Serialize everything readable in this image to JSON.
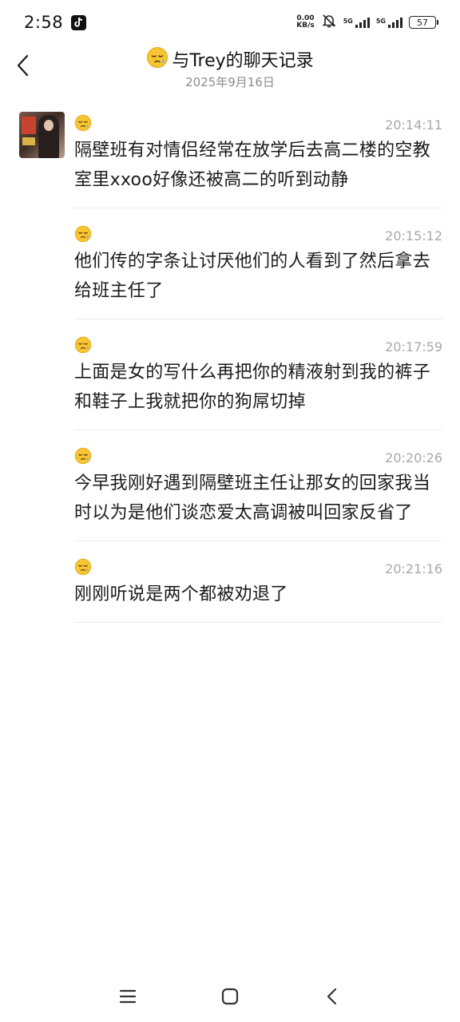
{
  "status_bar": {
    "time": "2:58",
    "net_speed_value": "0.00",
    "net_speed_unit": "KB/s",
    "signal_1_label": "5G",
    "signal_2_label": "5G",
    "battery_level": "57",
    "icons": [
      "tiktok-icon",
      "mute-bell-icon",
      "signal-icon",
      "battery-icon"
    ]
  },
  "header": {
    "title_emoji": "sleepy-face-icon",
    "title": "与Trey的聊天记录",
    "date": "2025年9月16日"
  },
  "messages": [
    {
      "time": "20:14:11",
      "text": "隔壁班有对情侣经常在放学后去高二楼的空教室里xxoo好像还被高二的听到动静"
    },
    {
      "time": "20:15:12",
      "text": "他们传的字条让讨厌他们的人看到了然后拿去给班主任了"
    },
    {
      "time": "20:17:59",
      "text": "上面是女的写什么再把你的精液射到我的裤子和鞋子上我就把你的狗屌切掉"
    },
    {
      "time": "20:20:26",
      "text": "今早我刚好遇到隔壁班主任让那女的回家我当时以为是他们谈恋爱太高调被叫回家反省了"
    },
    {
      "time": "20:21:16",
      "text": "刚刚听说是两个都被劝退了"
    }
  ],
  "nav_bar": {
    "icons": [
      "menu-icon",
      "home-icon",
      "back-icon"
    ]
  },
  "colors": {
    "background": "#ffffff",
    "text_primary": "#1b1b1b",
    "text_secondary": "#8c8c8c",
    "timestamp": "#a9a9a9",
    "divider": "#ececec"
  }
}
